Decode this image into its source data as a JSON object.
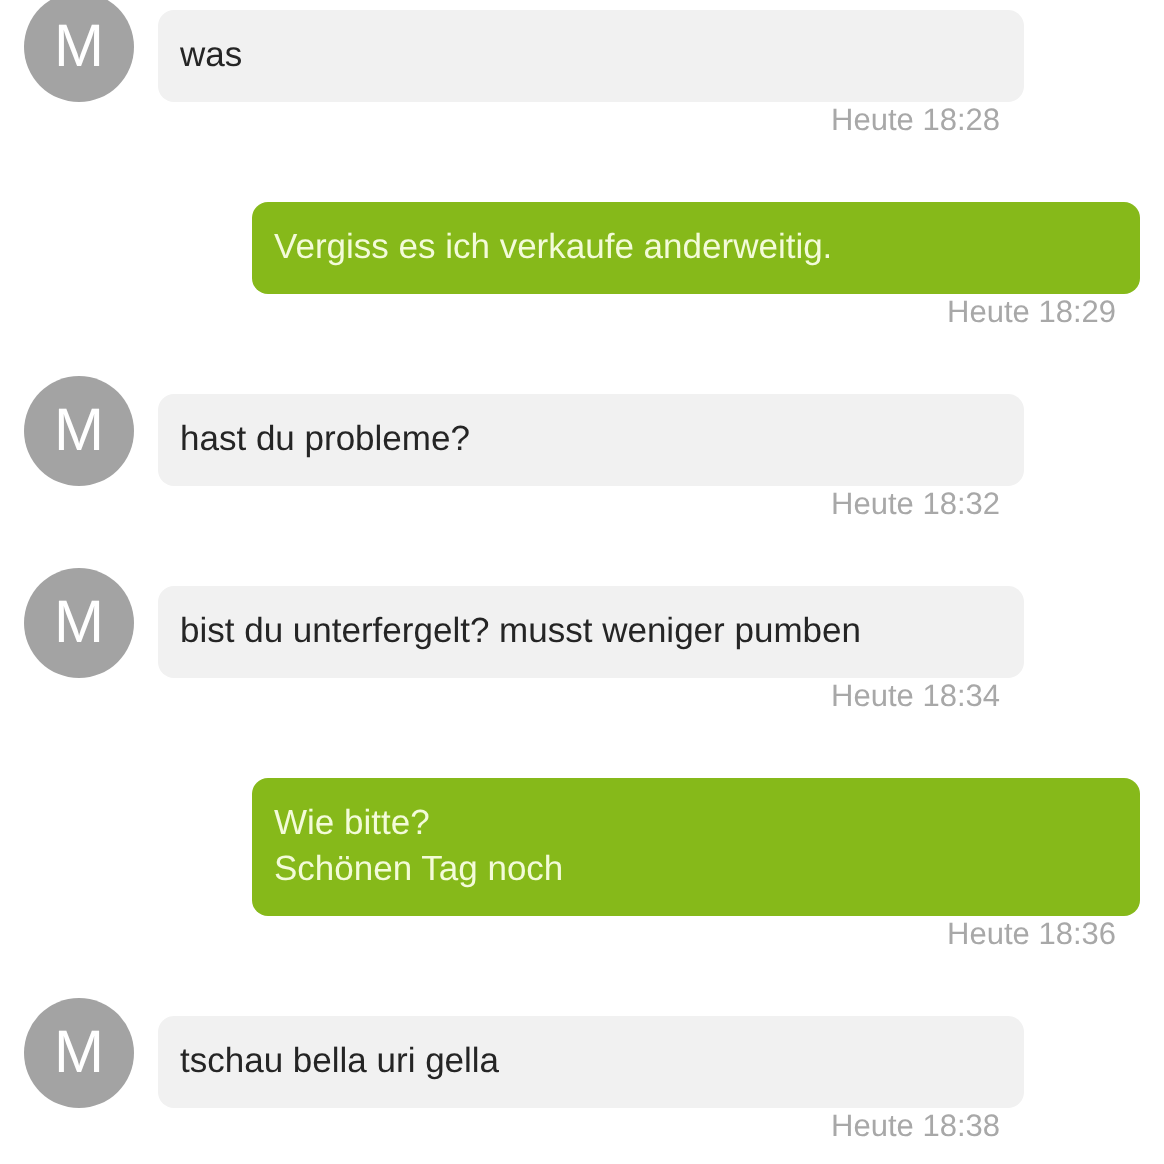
{
  "messages": [
    {
      "kind": "incoming",
      "avatar": "M",
      "lines": [
        "was"
      ],
      "time": "Heute 18:28"
    },
    {
      "kind": "outgoing",
      "lines": [
        "Vergiss es ich verkaufe anderweitig."
      ],
      "time": "Heute 18:29"
    },
    {
      "kind": "incoming",
      "avatar": "M",
      "lines": [
        "hast du probleme?"
      ],
      "time": "Heute 18:32"
    },
    {
      "kind": "incoming",
      "avatar": "M",
      "lines": [
        "bist du unterfergelt? musst weniger pumben"
      ],
      "time": "Heute 18:34"
    },
    {
      "kind": "outgoing",
      "lines": [
        "Wie bitte?",
        "Schönen Tag noch"
      ],
      "time": "Heute 18:36"
    },
    {
      "kind": "incoming",
      "avatar": "M",
      "lines": [
        "tschau bella uri gella"
      ],
      "time": "Heute 18:38"
    }
  ]
}
